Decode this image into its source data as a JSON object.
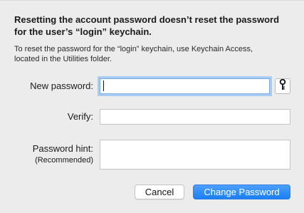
{
  "dialog": {
    "headline_line1": "Resetting the account password doesn’t reset the password",
    "headline_line2": "for the user’s “login” keychain.",
    "info_line1": "To reset the password for the “login” keychain, use Keychain Access,",
    "info_line2": "located in the Utilities folder."
  },
  "form": {
    "new_password_label": "New password:",
    "new_password_value": "",
    "verify_label": "Verify:",
    "verify_value": "",
    "hint_label": "Password hint:",
    "hint_sublabel": "(Recommended)",
    "hint_value": ""
  },
  "buttons": {
    "cancel": "Cancel",
    "change_password": "Change Password"
  },
  "icons": {
    "password_assistant": "key-icon"
  },
  "colors": {
    "primary_button": "#1a7ff4",
    "focus_ring": "#a9cdf2",
    "background": "#ececec"
  }
}
